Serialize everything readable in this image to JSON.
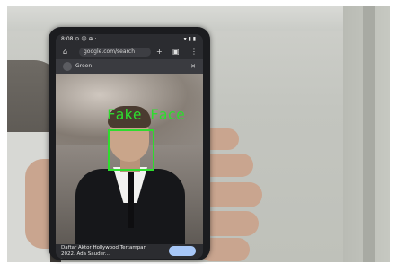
{
  "detection": {
    "label": "Fake Face",
    "color": "#2edc2e"
  },
  "phone_screen": {
    "status_time": "8:08 ⊙ ☺ ⊕ ·",
    "status_right": "▾ ▮ ▮",
    "url": "google.com/search",
    "tab_title": "Green",
    "caption": "Daftar Aktor Hollywood Tertampan 2022. Ada Sauder...",
    "share_glyph": "⊗"
  },
  "icons": [
    "home-icon",
    "add-tab-icon",
    "tabs-icon",
    "menu-icon",
    "close-icon"
  ]
}
